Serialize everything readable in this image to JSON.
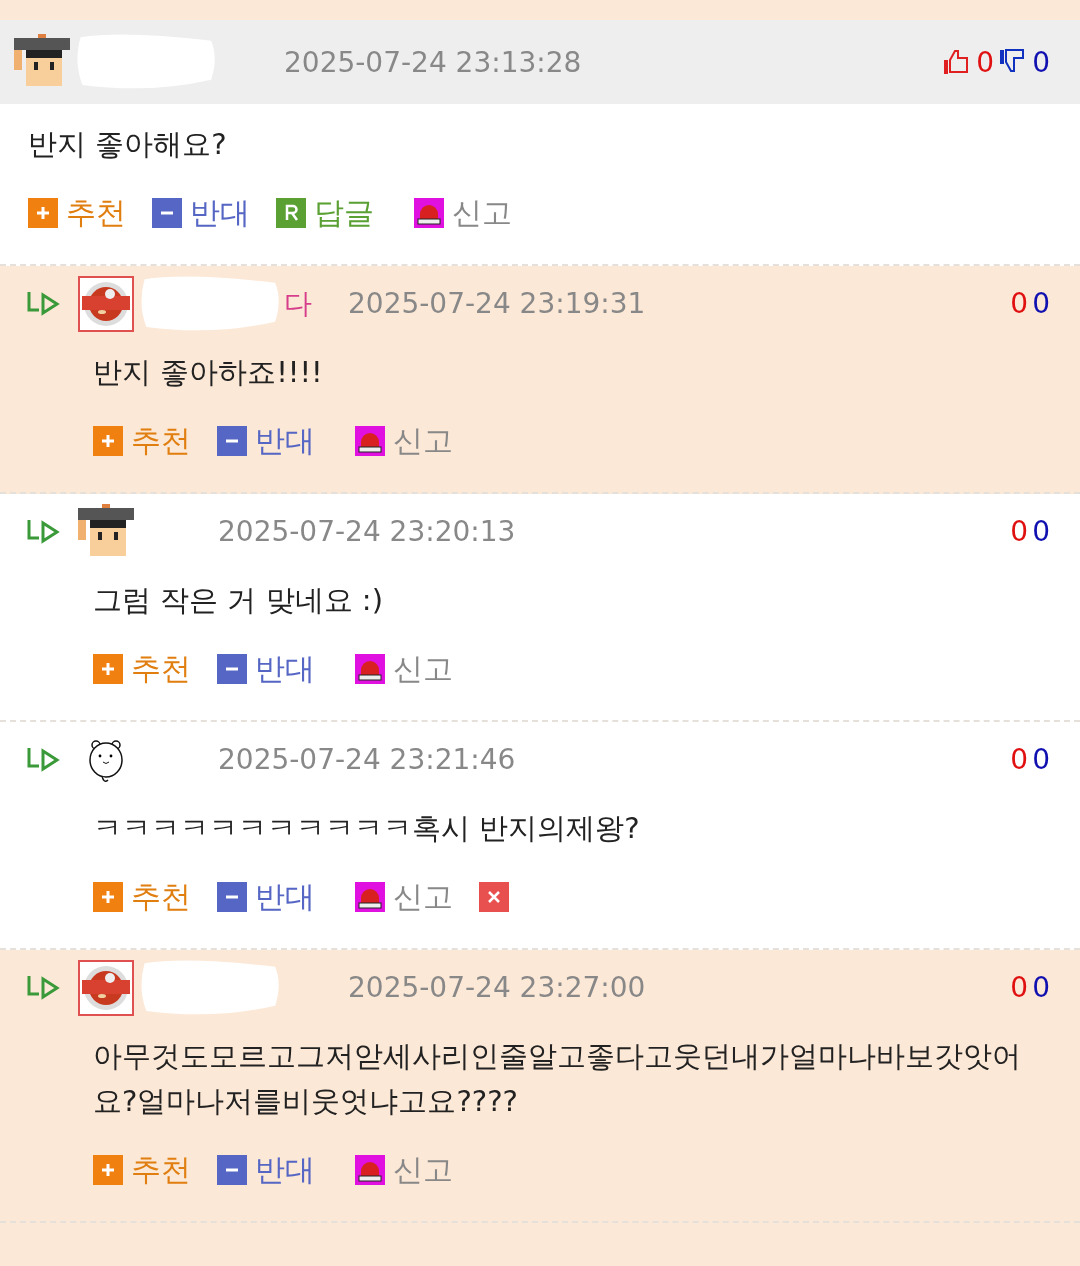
{
  "comments": [
    {
      "kind": "top",
      "avatar": {
        "kind": "scholar"
      },
      "redacted": true,
      "highlighted": false,
      "date": "2025-07-24 23:13:28",
      "up": "0",
      "down": "0",
      "text": "반지 좋아해요?",
      "actions": [
        {
          "kind": "up",
          "label": "추천"
        },
        {
          "kind": "down",
          "label": "반대"
        },
        {
          "kind": "reply",
          "label": "답글"
        },
        {
          "kind": "report",
          "label": "신고"
        }
      ]
    },
    {
      "kind": "reply",
      "avatar": {
        "kind": "food"
      },
      "redacted": true,
      "name_tail": "다",
      "highlighted": true,
      "date": "2025-07-24 23:19:31",
      "up": "0",
      "down": "0",
      "text": "반지 좋아하죠!!!!",
      "actions": [
        {
          "kind": "up",
          "label": "추천"
        },
        {
          "kind": "down",
          "label": "반대"
        },
        {
          "kind": "report",
          "label": "신고"
        }
      ]
    },
    {
      "kind": "reply",
      "avatar": {
        "kind": "scholar"
      },
      "redacted": false,
      "highlighted": false,
      "date": "2025-07-24 23:20:13",
      "up": "0",
      "down": "0",
      "text": "그럼 작은 거 맞네요 :)",
      "actions": [
        {
          "kind": "up",
          "label": "추천"
        },
        {
          "kind": "down",
          "label": "반대"
        },
        {
          "kind": "report",
          "label": "신고"
        }
      ]
    },
    {
      "kind": "reply",
      "avatar": {
        "kind": "bear"
      },
      "redacted": false,
      "highlighted": false,
      "date": "2025-07-24 23:21:46",
      "up": "0",
      "down": "0",
      "text": "ㅋㅋㅋㅋㅋㅋㅋㅋㅋㅋㅋ혹시 반지의제왕?",
      "actions": [
        {
          "kind": "up",
          "label": "추천"
        },
        {
          "kind": "down",
          "label": "반대"
        },
        {
          "kind": "report",
          "label": "신고"
        },
        {
          "kind": "delete"
        }
      ]
    },
    {
      "kind": "reply",
      "avatar": {
        "kind": "food"
      },
      "redacted": true,
      "highlighted": true,
      "date": "2025-07-24 23:27:00",
      "up": "0",
      "down": "0",
      "text": "아무것도모르고그저앋세사리인줄알고좋다고웃던내가얼마나바보갓앗어요?얼마나저를비웃엇냐고요????",
      "actions": [
        {
          "kind": "up",
          "label": "추천"
        },
        {
          "kind": "down",
          "label": "반대"
        },
        {
          "kind": "report",
          "label": "신고"
        }
      ]
    }
  ]
}
